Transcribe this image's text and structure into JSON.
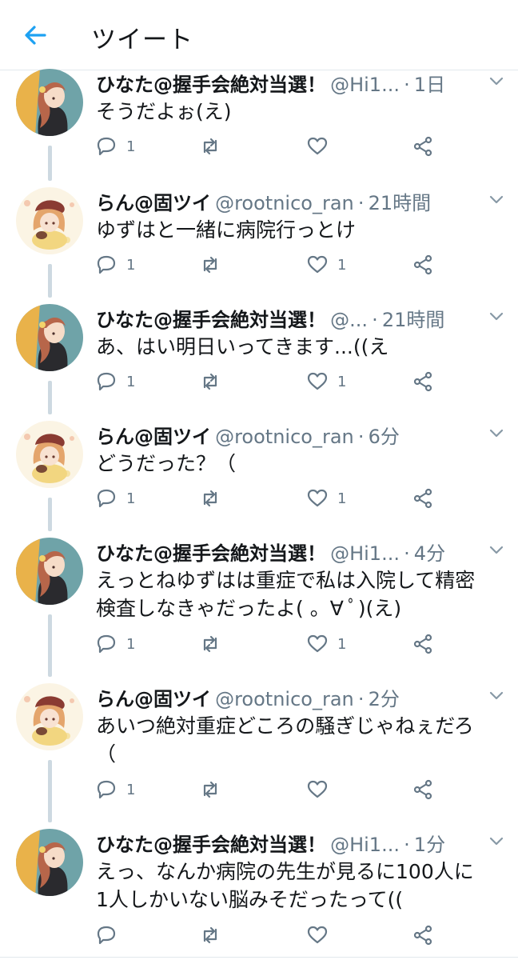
{
  "header": {
    "title": "ツイート",
    "back_icon": "back-arrow-icon"
  },
  "colors": {
    "accent": "#1da1f2",
    "text": "#14171a",
    "muted": "#657786",
    "thread_line": "#cdd9e1"
  },
  "tweets": [
    {
      "name": "ひなた@握手会絶対当選！",
      "handle": "@Hi1...",
      "sep": "·",
      "time": "1日",
      "text": "そうだよぉ(え)",
      "reply_count": "1",
      "like_count": "",
      "avatar": "hinata-avatar"
    },
    {
      "name": "らん@固ツイ",
      "handle": "@rootnico_ran",
      "sep": "·",
      "time": "21時間",
      "text": "ゆずはと一緒に病院行っとけ",
      "reply_count": "1",
      "like_count": "1",
      "avatar": "ran-avatar"
    },
    {
      "name": "ひなた@握手会絶対当選！",
      "handle": "@...",
      "sep": "·",
      "time": "21時間",
      "text": "あ、はい明日いってきます...((え",
      "reply_count": "1",
      "like_count": "1",
      "avatar": "hinata-avatar"
    },
    {
      "name": "らん@固ツイ",
      "handle": "@rootnico_ran",
      "sep": "·",
      "time": "6分",
      "text": "どうだった？（",
      "reply_count": "1",
      "like_count": "1",
      "avatar": "ran-avatar"
    },
    {
      "name": "ひなた@握手会絶対当選！",
      "handle": "@Hi1...",
      "sep": "·",
      "time": "4分",
      "text": "えっとねゆずはは重症で私は入院して精密検査しなきゃだったよ( 。∀ ﾟ)(え)",
      "reply_count": "1",
      "like_count": "1",
      "avatar": "hinata-avatar"
    },
    {
      "name": "らん@固ツイ",
      "handle": "@rootnico_ran",
      "sep": "·",
      "time": "2分",
      "text": "あいつ絶対重症どころの騒ぎじゃねぇだろ（",
      "reply_count": "1",
      "like_count": "",
      "avatar": "ran-avatar"
    },
    {
      "name": "ひなた@握手会絶対当選！",
      "handle": "@Hi1...",
      "sep": "·",
      "time": "1分",
      "text": "えっ、なんか病院の先生が見るに100人に1人しかいない脳みそだったって((",
      "reply_count": "",
      "like_count": "",
      "avatar": "hinata-avatar"
    }
  ]
}
